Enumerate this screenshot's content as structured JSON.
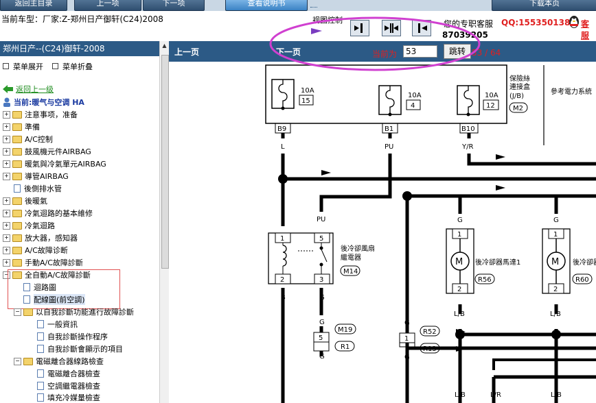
{
  "toolbar": {
    "buttons": [
      {
        "label": "返回主目录"
      },
      {
        "label": "上一项"
      },
      {
        "label": "下一项"
      },
      {
        "label": "查看说明书"
      },
      {
        "label": "下载本页"
      }
    ]
  },
  "info": {
    "vehicle": "当前车型：厂家:Z-郑州日产御轩(C24)2008",
    "view_control_label": "视图控制"
  },
  "support": {
    "title": "您的专职客服",
    "qq": "QQ:1553501388",
    "extra": "客服",
    "phone": "87039205"
  },
  "sidebar": {
    "header": "郑州日产--(C24)御轩-2008",
    "expand_label": "菜单展开",
    "collapse_label": "菜单折叠",
    "back_label": "返回上一级",
    "current_label": "当前:暖气与空调 HA",
    "items": [
      {
        "label": "注意事项，准备"
      },
      {
        "label": "準備"
      },
      {
        "label": "A/C控制"
      },
      {
        "label": "鼓風機元件AIRBAG"
      },
      {
        "label": "暖氣與冷氣單元AIRBAG"
      },
      {
        "label": "導管AIRBAG"
      },
      {
        "label": "後側排水管"
      },
      {
        "label": "後暖氣"
      },
      {
        "label": "冷氣迴路的基本維修"
      },
      {
        "label": "冷氣迴路"
      },
      {
        "label": "放大器，感知器"
      },
      {
        "label": "A/C故障诊断"
      },
      {
        "label": "手動A/C故障診斷"
      },
      {
        "label": "全自動A/C故障診斷"
      },
      {
        "label": "迴路圖"
      },
      {
        "label": "配線圖(前空調)"
      },
      {
        "label": "以自我診斷功能進行故障診斷"
      },
      {
        "label": "一般資訊"
      },
      {
        "label": "自我診斷操作程序"
      },
      {
        "label": "自我診斷會顯示的項目"
      },
      {
        "label": "電磁離合器線路檢查"
      },
      {
        "label": "電磁離合器檢查"
      },
      {
        "label": "空調繼電器檢查"
      },
      {
        "label": "填充冷媒量檢查"
      }
    ]
  },
  "pager": {
    "prev_label": "上一页",
    "next_label": "下一页",
    "current_label": "当前为",
    "current_page": "53",
    "jump_label": "跳转",
    "total": "53 / 64"
  },
  "diagram": {
    "fuse_block_label": "保險絲\n連接盒\n(J/B)",
    "fuse_block_conn": "M2",
    "ref_text": "參考電力系統",
    "fuses": [
      {
        "amp": "10A",
        "num": "15",
        "conn": "B9",
        "wire": "L"
      },
      {
        "amp": "10A",
        "num": "4",
        "conn": "B1",
        "wire": "PU"
      },
      {
        "amp": "10A",
        "num": "12",
        "conn": "B10",
        "wire": "Y/R"
      }
    ],
    "relay_label": "後冷卻風扇\n繼電器",
    "relay_conn": "M14",
    "motor1_label": "後冷卻器馬達1",
    "motor1_conn": "R56",
    "motor2_label": "後冷卻器",
    "motor2_conn": "R60",
    "connectors": [
      "M19",
      "R1",
      "R52",
      "R13"
    ],
    "wire_labels": [
      "L",
      "PU",
      "B",
      "G",
      "G",
      "G",
      "G",
      "G",
      "L/B",
      "L/B",
      "L/B",
      "L/R",
      "L/B"
    ]
  },
  "colors": {
    "nav_bg": "#2c5a86",
    "annotation": "#d040d0",
    "highlight_box": "#e05050",
    "accent_red": "#e02020"
  }
}
